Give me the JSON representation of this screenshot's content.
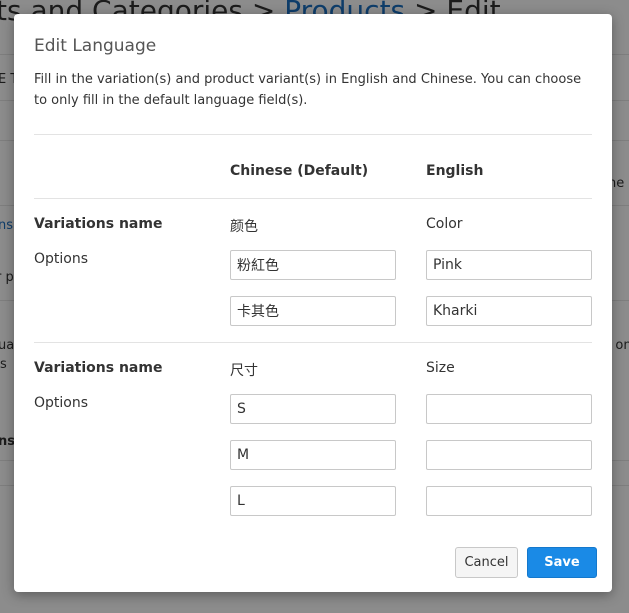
{
  "background": {
    "breadcrumb_a": "ts and Categories > ",
    "breadcrumb_link": "Products",
    "breadcrumb_b": " > Edit",
    "frag_1": "E T",
    "frag_2": "ns",
    "frag_3": "r pr",
    "frag_4": "uag",
    "frag_5": "s",
    "frag_6": "ns",
    "frag_7": "ne",
    "frag_8": "d on"
  },
  "modal": {
    "title": "Edit Language",
    "description": "Fill in the variation(s) and product variant(s) in English and Chinese. You can choose to only fill in the default language field(s).",
    "columns": {
      "chinese": "Chinese (Default)",
      "english": "English"
    },
    "group1": {
      "label": "Variations name",
      "name_zh": "颜色",
      "name_en": "Color",
      "options_label": "Options",
      "options": [
        {
          "zh": "粉紅色",
          "en": "Pink"
        },
        {
          "zh": "卡其色",
          "en": "Kharki"
        }
      ]
    },
    "group2": {
      "label": "Variations name",
      "name_zh": "尺寸",
      "name_en": "Size",
      "options_label": "Options",
      "options": [
        {
          "zh": "S",
          "en": ""
        },
        {
          "zh": "M",
          "en": ""
        },
        {
          "zh": "L",
          "en": ""
        }
      ]
    },
    "buttons": {
      "cancel": "Cancel",
      "save": "Save"
    }
  },
  "colors": {
    "primary": "#1a8ae6",
    "link": "#1b6fc2",
    "overlay": "rgba(0,0,0,0.45)"
  }
}
